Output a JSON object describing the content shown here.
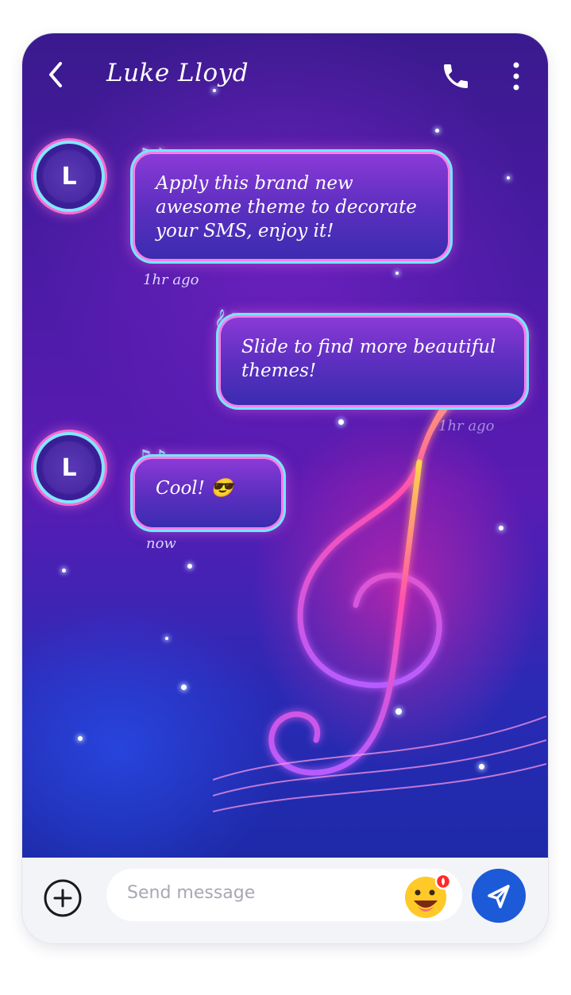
{
  "header": {
    "contact_name": "Luke Lloyd"
  },
  "messages": [
    {
      "avatar": "L",
      "text": "Apply this brand new awesome theme to decorate your SMS, enjoy it!",
      "time": "1hr ago",
      "direction": "incoming"
    },
    {
      "text": "Slide to find more beautiful themes!",
      "time": "1hr ago",
      "direction": "outgoing"
    },
    {
      "avatar": "L",
      "text": "Cool! 😎",
      "time": "now",
      "direction": "incoming"
    }
  ],
  "composer": {
    "placeholder": "Send message"
  },
  "icons": {
    "back": "chevron-left-icon",
    "call": "phone-icon",
    "more": "vertical-dots-icon",
    "add": "plus-circle-icon",
    "emoji": "emoji-icon",
    "send": "send-icon",
    "notes": "music-notes-icon"
  },
  "colors": {
    "send_button": "#1d5ad8",
    "bubble_glow": "#ff7de8",
    "bubble_rim": "#6fe9ff"
  }
}
